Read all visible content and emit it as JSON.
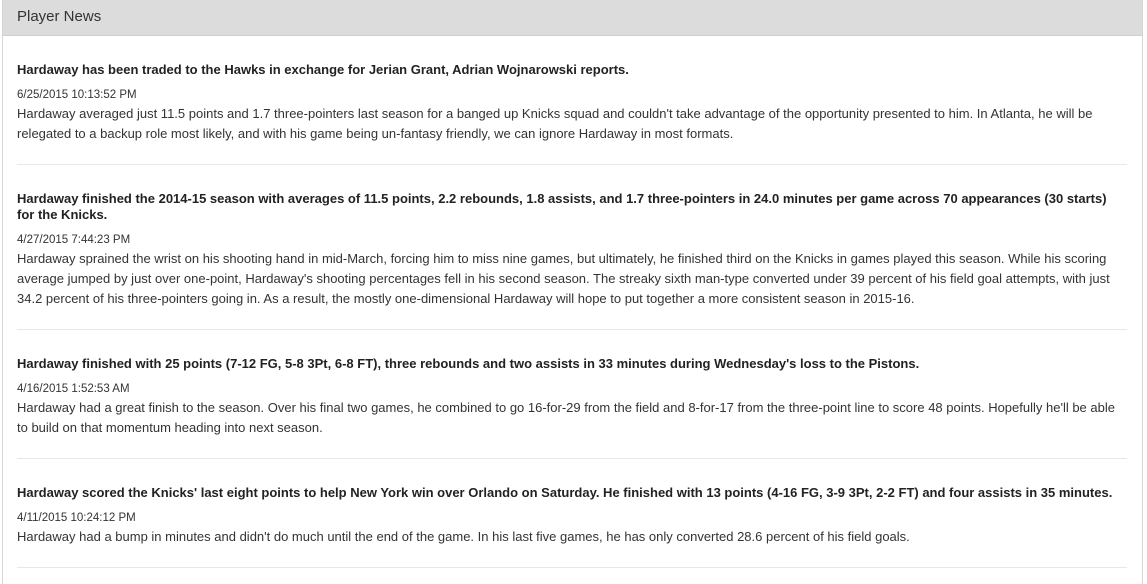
{
  "panel": {
    "title": "Player News"
  },
  "news": [
    {
      "headline": "Hardaway has been traded to the Hawks in exchange for Jerian Grant, Adrian Wojnarowski reports.",
      "timestamp": "6/25/2015 10:13:52 PM",
      "body": "Hardaway averaged just 11.5 points and 1.7 three-pointers last season for a banged up Knicks squad and couldn't take advantage of the opportunity presented to him. In Atlanta, he will be relegated to a backup role most likely, and with his game being un-fantasy friendly, we can ignore Hardaway in most formats."
    },
    {
      "headline": "Hardaway finished the 2014-15 season with averages of 11.5 points, 2.2 rebounds, 1.8 assists, and 1.7 three-pointers in 24.0 minutes per game across 70 appearances (30 starts) for the Knicks.",
      "timestamp": "4/27/2015 7:44:23 PM",
      "body": "Hardaway sprained the wrist on his shooting hand in mid-March, forcing him to miss nine games, but ultimately, he finished third on the Knicks in games played this season. While his scoring average jumped by just over one-point, Hardaway's shooting percentages fell in his second season. The streaky sixth man-type converted under 39 percent of his field goal attempts, with just 34.2 percent of his three-pointers going in. As a result, the mostly one-dimensional Hardaway will hope to put together a more consistent season in 2015-16."
    },
    {
      "headline": "Hardaway finished with 25 points (7-12 FG, 5-8 3Pt, 6-8 FT), three rebounds and two assists in 33 minutes during Wednesday's loss to the Pistons.",
      "timestamp": "4/16/2015 1:52:53 AM",
      "body": "Hardaway had a great finish to the season. Over his final two games, he combined to go 16-for-29 from the field and 8-for-17 from the three-point line to score 48 points. Hopefully he'll be able to build on that momentum heading into next season."
    },
    {
      "headline": "Hardaway scored the Knicks' last eight points to help New York win over Orlando on Saturday. He finished with 13 points (4-16 FG, 3-9 3Pt, 2-2 FT) and four assists in 35 minutes.",
      "timestamp": "4/11/2015 10:24:12 PM",
      "body": "Hardaway had a bump in minutes and didn't do much until the end of the game. In his last five games, he has only converted 28.6 percent of his field goals."
    }
  ]
}
